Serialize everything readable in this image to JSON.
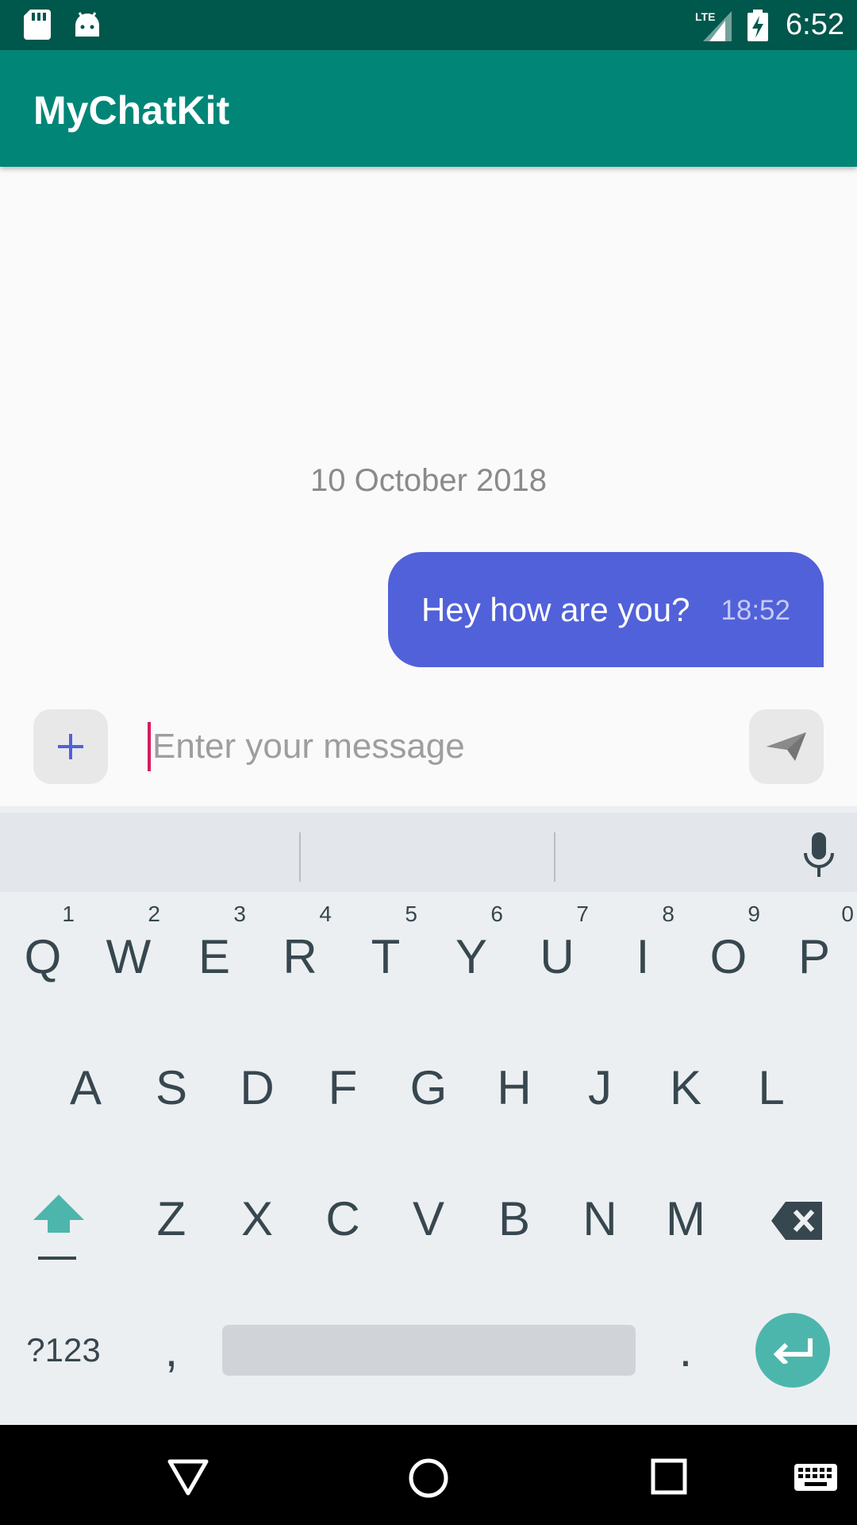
{
  "status_bar": {
    "time": "6:52",
    "network": "LTE",
    "icons": [
      "sd-card-icon",
      "android-icon",
      "lte-signal-icon",
      "battery-charging-icon"
    ]
  },
  "app_bar": {
    "title": "MyChatKit"
  },
  "conversation": {
    "date_header": "10 October 2018",
    "messages": [
      {
        "text": "Hey how are you?",
        "time": "18:52",
        "outgoing": true
      }
    ]
  },
  "composer": {
    "add_icon": "plus-icon",
    "placeholder": "Enter your message",
    "value": "",
    "send_icon": "send-icon"
  },
  "keyboard": {
    "row1": [
      {
        "key": "Q",
        "hint": "1"
      },
      {
        "key": "W",
        "hint": "2"
      },
      {
        "key": "E",
        "hint": "3"
      },
      {
        "key": "R",
        "hint": "4"
      },
      {
        "key": "T",
        "hint": "5"
      },
      {
        "key": "Y",
        "hint": "6"
      },
      {
        "key": "U",
        "hint": "7"
      },
      {
        "key": "I",
        "hint": "8"
      },
      {
        "key": "O",
        "hint": "9"
      },
      {
        "key": "P",
        "hint": "0"
      }
    ],
    "row2": [
      "A",
      "S",
      "D",
      "F",
      "G",
      "H",
      "J",
      "K",
      "L"
    ],
    "row3": [
      "Z",
      "X",
      "C",
      "V",
      "B",
      "N",
      "M"
    ],
    "symbols_label": "?123",
    "comma": ",",
    "period": ".",
    "icons": [
      "mic-icon",
      "shift-icon",
      "backspace-icon",
      "enter-icon"
    ]
  },
  "nav_bar": {
    "icons": [
      "back-icon",
      "home-icon",
      "recents-icon",
      "keyboard-switch-icon"
    ]
  },
  "colors": {
    "status_bar": "#00574b",
    "app_bar": "#008577",
    "bubble": "#5161d9",
    "caret": "#d81b60",
    "accent": "#4db6ac",
    "add_icon": "#5161d9"
  }
}
